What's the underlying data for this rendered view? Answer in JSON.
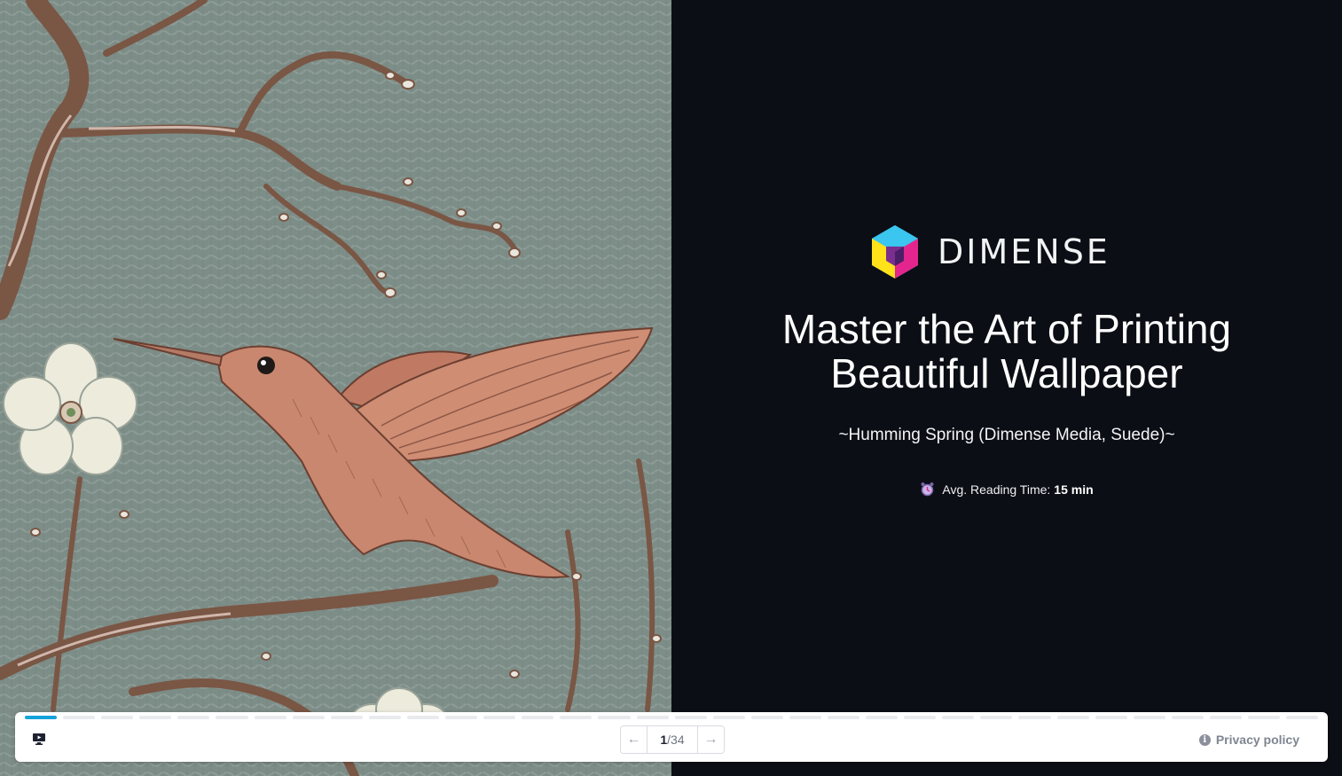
{
  "hero": {
    "image_alt": "Humming Spring wallpaper artwork with hummingbird and blossom branches",
    "brand_name": "DIMENSE",
    "title_line1": "Master the Art of Printing",
    "title_line2": "Beautiful Wallpaper",
    "subtitle": "~Humming Spring (Dimense Media, Suede)~",
    "reading_label": "Avg. Reading Time:",
    "reading_value": "15 min"
  },
  "footer": {
    "current_page": "1",
    "separator": "/",
    "total_pages": "34",
    "privacy_label": "Privacy policy",
    "prev_icon": "arrow-left-icon",
    "next_icon": "arrow-right-icon",
    "present_icon": "presentation-icon"
  },
  "progress": {
    "segments": 34,
    "active_index": 0
  },
  "colors": {
    "accent": "#13a3db",
    "panel_bg": "#0c0e15",
    "art_bg": "#7f8f89",
    "bird": "#c9876f",
    "branch": "#7a5645"
  }
}
